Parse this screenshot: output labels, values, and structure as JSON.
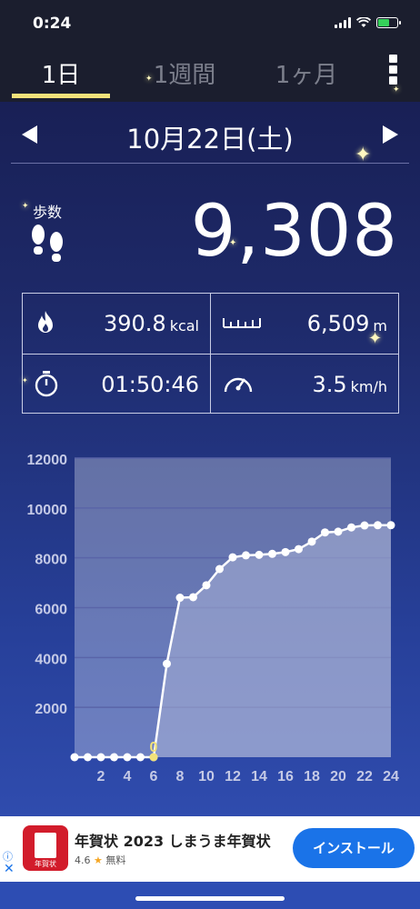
{
  "status": {
    "time": "0:24"
  },
  "tabs": [
    {
      "label": "1日",
      "active": true
    },
    {
      "label": "1週間",
      "active": false
    },
    {
      "label": "1ヶ月",
      "active": false
    }
  ],
  "date": {
    "label": "10月22日(土)"
  },
  "steps": {
    "label": "歩数",
    "value": "9,308"
  },
  "stats": {
    "calories": {
      "value": "390.8",
      "unit": "kcal",
      "icon": "fire-icon"
    },
    "distance": {
      "value": "6,509",
      "unit": "m",
      "icon": "ruler-icon"
    },
    "time": {
      "value": "01:50:46",
      "icon": "stopwatch-icon"
    },
    "speed": {
      "value": "3.5",
      "unit": "km/h",
      "icon": "speedometer-icon"
    }
  },
  "chart_data": {
    "type": "line",
    "x": [
      0,
      1,
      2,
      3,
      4,
      5,
      6,
      7,
      8,
      9,
      10,
      11,
      12,
      13,
      14,
      15,
      16,
      17,
      18,
      19,
      20,
      21,
      22,
      23,
      24
    ],
    "y": [
      0,
      0,
      0,
      0,
      0,
      0,
      0,
      3750,
      6400,
      6420,
      6900,
      7550,
      8020,
      8100,
      8120,
      8160,
      8230,
      8350,
      8650,
      9020,
      9050,
      9220,
      9300,
      9308,
      9308
    ],
    "xticks": [
      "2",
      "4",
      "6",
      "8",
      "10",
      "12",
      "14",
      "16",
      "18",
      "20",
      "22",
      "24"
    ],
    "yticks": [
      "2000",
      "4000",
      "6000",
      "8000",
      "10000",
      "12000"
    ],
    "ylim": [
      0,
      12000
    ],
    "xlim": [
      0,
      24
    ],
    "annotation": {
      "x": 6,
      "label": "0"
    },
    "colors": {
      "line": "#ffffff",
      "fill": "#a8b0d6",
      "annotation": "#f2e27a"
    }
  },
  "ad": {
    "title": "年賀状 2023 しまうま年賀状",
    "rating": "4.6",
    "price": "無料",
    "install_label": "インストール",
    "icon_tag": "年賀状"
  },
  "colors": {
    "accent": "#f2e27a",
    "install": "#1a73e8"
  }
}
